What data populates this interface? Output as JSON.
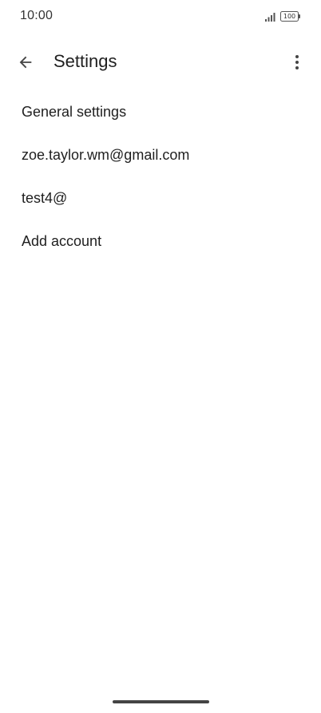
{
  "status_bar": {
    "time": "10:00",
    "battery_level": "100",
    "signal_icon": "signal-bars-icon",
    "battery_icon": "battery-icon"
  },
  "app_bar": {
    "title": "Settings",
    "back_icon": "arrow-back-icon",
    "more_icon": "more-vertical-icon"
  },
  "settings_list": {
    "items": [
      {
        "label": "General settings"
      },
      {
        "label": "zoe.taylor.wm@gmail.com"
      },
      {
        "label": "test4@"
      },
      {
        "label": "Add account"
      }
    ]
  },
  "colors": {
    "background": "#ffffff",
    "text_primary": "#1f1f1f",
    "icon": "#444444"
  }
}
